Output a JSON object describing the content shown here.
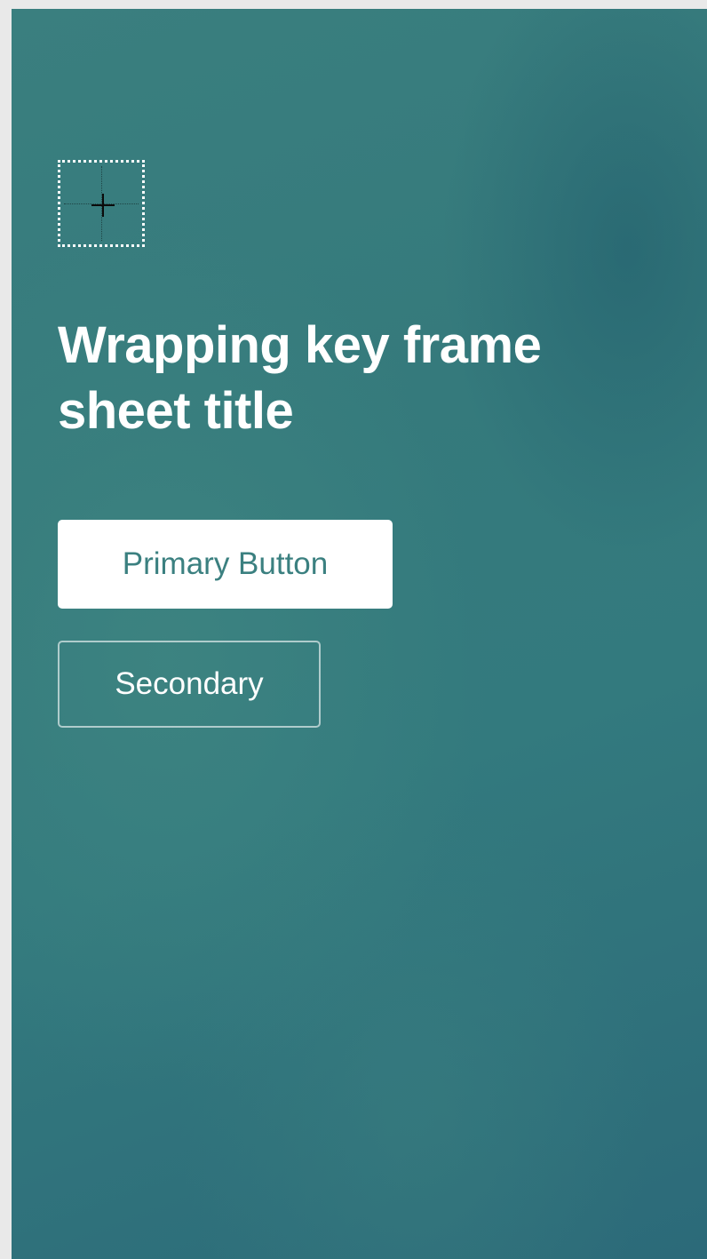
{
  "sheet": {
    "title": "Wrapping key frame sheet title",
    "background_colors": [
      "#3a7f7f",
      "#337a7e",
      "#2c6a79"
    ]
  },
  "image_placeholder": {
    "icon": "plus-icon"
  },
  "buttons": {
    "primary_label": "Primary Button",
    "secondary_label": "Secondary"
  },
  "colors": {
    "primary_button_bg": "#ffffff",
    "primary_button_text": "#3b8080",
    "secondary_button_text": "#ffffff"
  }
}
